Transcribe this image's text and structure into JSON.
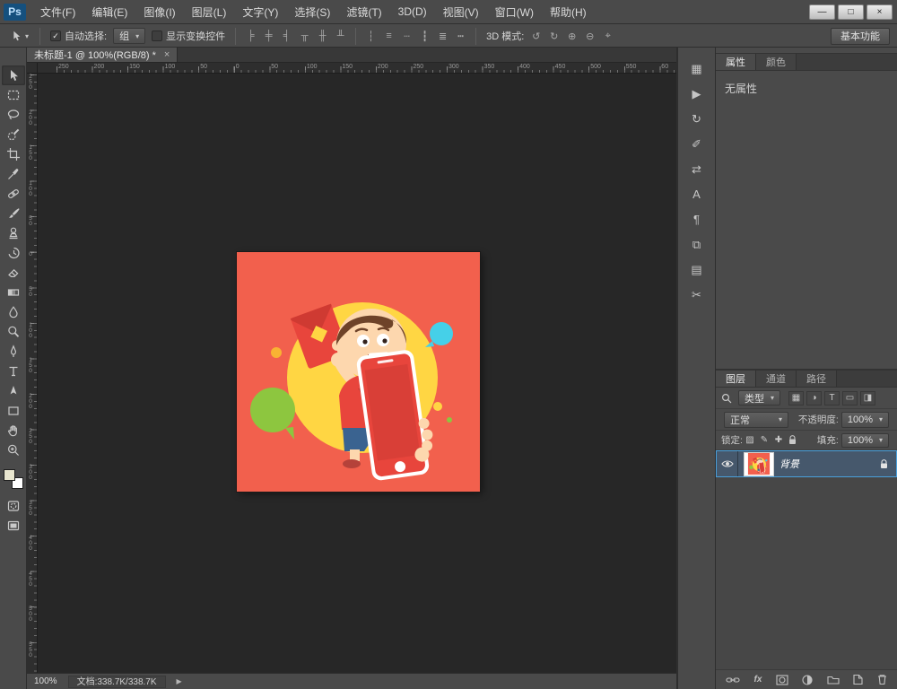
{
  "titlebar": {
    "logo": "Ps",
    "menus": [
      "文件(F)",
      "编辑(E)",
      "图像(I)",
      "图层(L)",
      "文字(Y)",
      "选择(S)",
      "滤镜(T)",
      "3D(D)",
      "视图(V)",
      "窗口(W)",
      "帮助(H)"
    ],
    "window_buttons": {
      "minimize": "—",
      "maximize": "□",
      "close": "×"
    }
  },
  "options_bar": {
    "auto_select_label": "自动选择:",
    "auto_select_value": "组",
    "show_transform_label": "显示变换控件",
    "mode_3d_label": "3D 模式:",
    "workspace_button": "基本功能"
  },
  "document": {
    "tab_title": "未标题-1 @ 100%(RGB/8) *",
    "close_glyph": "×"
  },
  "rulers": {
    "horizontal": [
      "250",
      "200",
      "150",
      "100",
      "50",
      "0",
      "50",
      "100",
      "150",
      "200",
      "250",
      "300",
      "350",
      "400",
      "450",
      "500",
      "550",
      "60"
    ],
    "vertical": [
      "250",
      "200",
      "150",
      "100",
      "50",
      "0",
      "50",
      "100",
      "150",
      "200",
      "250",
      "300",
      "350",
      "400",
      "450",
      "500",
      "550"
    ]
  },
  "toolbar": {
    "tools": [
      "move",
      "rectangular-marquee",
      "lasso",
      "quick-selection",
      "crop",
      "eyedropper",
      "spot-healing-brush",
      "brush",
      "clone-stamp",
      "history-brush",
      "eraser",
      "gradient",
      "blur",
      "dodge",
      "pen",
      "horizontal-type",
      "path-selection",
      "rectangle",
      "hand",
      "zoom"
    ]
  },
  "properties_panel": {
    "tabs": [
      "属性",
      "颜色"
    ],
    "empty_text": "无属性"
  },
  "layers_panel": {
    "tabs": [
      "图层",
      "通道",
      "路径"
    ],
    "filter_label": "类型",
    "blend_mode": "正常",
    "opacity_label": "不透明度:",
    "opacity_value": "100%",
    "lock_label": "锁定:",
    "fill_label": "填充:",
    "fill_value": "100%",
    "layers": [
      {
        "name": "背景",
        "visible": true,
        "locked": true
      }
    ]
  },
  "status_bar": {
    "zoom": "100%",
    "doc_label": "文档:338.7K/338.7K"
  },
  "icons": {
    "caret": "▾",
    "check": "✓",
    "play": "▶",
    "align": [
      "╞",
      "╪",
      "╡",
      "╥",
      "╫",
      "╨"
    ],
    "distribute": [
      "┆",
      "≡",
      "┄",
      "┇",
      "≣",
      "┅"
    ],
    "mode3d": [
      "↺",
      "↻",
      "⊕",
      "⊖",
      "⌖"
    ],
    "panel_strip": [
      {
        "name": "swatches",
        "glyph": "▦"
      },
      {
        "name": "actions",
        "glyph": "▶"
      },
      {
        "name": "history",
        "glyph": "↻"
      },
      {
        "name": "tool-presets",
        "glyph": "✐"
      },
      {
        "name": "adjustments",
        "glyph": "⇄"
      },
      {
        "name": "character",
        "glyph": "A"
      },
      {
        "name": "paragraph",
        "glyph": "¶"
      },
      {
        "name": "clone-source",
        "glyph": "⧉"
      },
      {
        "name": "notes",
        "glyph": "▤"
      },
      {
        "name": "measurement",
        "glyph": "✂"
      }
    ],
    "layer_filter": [
      "▦",
      "◑",
      "T",
      "▭",
      "◨"
    ],
    "lock_row": [
      "▨",
      "✎",
      "✚"
    ],
    "fx": "fx"
  },
  "artwork": {
    "description": "Cartoon boy holding a red smartphone and a red envelope on an orange background with a yellow circle halo, green and cyan speech bubbles",
    "colors": {
      "background": "#f2604d",
      "halo": "#ffd643",
      "bubble_green": "#8dc63f",
      "blob_cyan": "#45d0e8",
      "envelope": "#e8453c",
      "envelope_flap": "#cf3a32",
      "seal": "#ffd643",
      "shirt": "#e8453c",
      "shirt_accent": "#c93a32",
      "shorts": "#3a6390",
      "phone_body": "#e8453c",
      "phone_screen": "#d93f37",
      "skin": "#fdd7ae",
      "hair": "#6e4329",
      "accent_selection": "#49a0dc",
      "foreground_swatch": "#e9e6cf",
      "background_swatch": "#ffffff"
    }
  }
}
